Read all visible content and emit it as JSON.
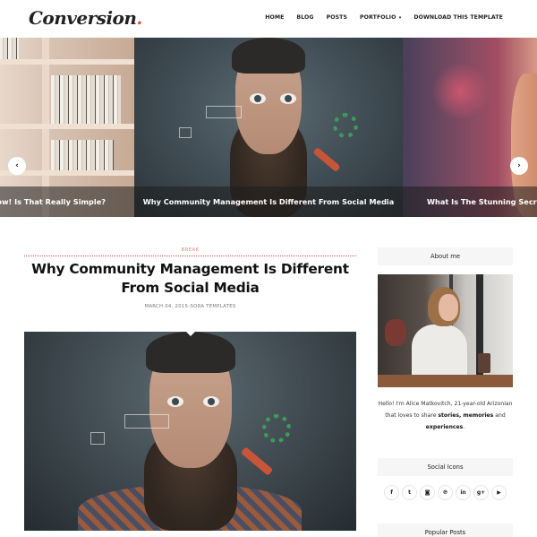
{
  "header": {
    "logo_text": "Conversion",
    "logo_dot": ".",
    "accent_color": "#e8524a",
    "nav": [
      {
        "label": "HOME"
      },
      {
        "label": "BLOG"
      },
      {
        "label": "POSTS"
      },
      {
        "label": "PORTFOLIO",
        "has_dropdown": true,
        "caret": "▾"
      },
      {
        "label": "DOWNLOAD THIS TEMPLATE"
      }
    ]
  },
  "slider": {
    "prev_icon": "‹",
    "next_icon": "›",
    "slides": [
      {
        "caption": "Start Now! Is That Really Simple?",
        "visible_caption": "t Now! Is That Really Simple?"
      },
      {
        "caption": "Why Community Management Is Different From Social Media"
      },
      {
        "caption": "What Is The Stunning Secret J"
      }
    ]
  },
  "post": {
    "category": "BREAK",
    "title": "Why Community Management Is Different From Social Media",
    "meta": "MARCH 04, 2015-SORA TEMPLATES"
  },
  "sidebar": {
    "about": {
      "title": "About me",
      "text_intro": "Hello! I'm Alice Matkovitch, 21-year-old Arizonian that loves to share ",
      "bold_1": "stories",
      "sep_1": ", ",
      "bold_2": "memories",
      "text_mid": " and ",
      "bold_3": "experiences",
      "text_end": "."
    },
    "social": {
      "title": "Social Icons",
      "icons": [
        {
          "name": "facebook",
          "glyph": "f"
        },
        {
          "name": "twitter",
          "glyph": "t"
        },
        {
          "name": "instagram",
          "glyph": "◙"
        },
        {
          "name": "pinterest",
          "glyph": "℗"
        },
        {
          "name": "linkedin",
          "glyph": "in"
        },
        {
          "name": "google-plus",
          "glyph": "g+"
        },
        {
          "name": "youtube",
          "glyph": "▶"
        }
      ]
    },
    "popular": {
      "title": "Popular Posts"
    }
  }
}
